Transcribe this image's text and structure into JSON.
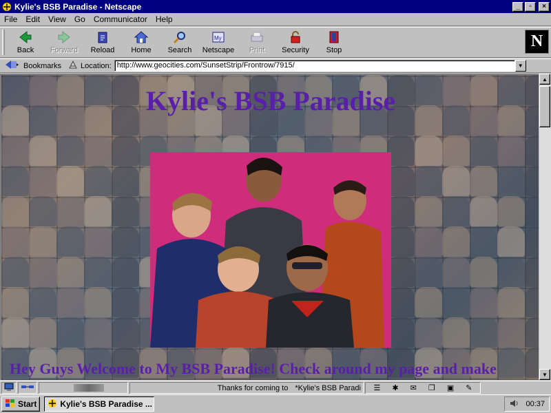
{
  "window": {
    "title": "Kylie's BSB Paradise - Netscape",
    "buttons": {
      "minimize": "_",
      "maximize": "▫",
      "close": "×"
    }
  },
  "menu": [
    {
      "label": "File"
    },
    {
      "label": "Edit"
    },
    {
      "label": "View"
    },
    {
      "label": "Go"
    },
    {
      "label": "Communicator"
    },
    {
      "label": "Help"
    }
  ],
  "toolbar": {
    "back": "Back",
    "forward": "Forward",
    "reload": "Reload",
    "home": "Home",
    "search": "Search",
    "netscape": "Netscape",
    "print": "Print",
    "security": "Security",
    "stop": "Stop",
    "logo": "N"
  },
  "location": {
    "bookmarks_label": "Bookmarks",
    "location_label": "Location:",
    "url": "http://www.geocities.com/SunsetStrip/Frontrow/7915/"
  },
  "page": {
    "heading": "Kylie's BSB Paradise",
    "welcome": "Hey Guys Welcome to My BSB Paradise!  Check around my page and make"
  },
  "status": {
    "message": "Thanks for coming to",
    "marquee": "*Kylie's BSB Paradi"
  },
  "taskbar": {
    "start": "Start",
    "task": "Kylie's BSB Paradise ...",
    "clock": "00:37"
  },
  "colors": {
    "heading": "#5a1fa8",
    "title_bar": "#000080",
    "photo_backdrop": "#cf2d7c"
  }
}
